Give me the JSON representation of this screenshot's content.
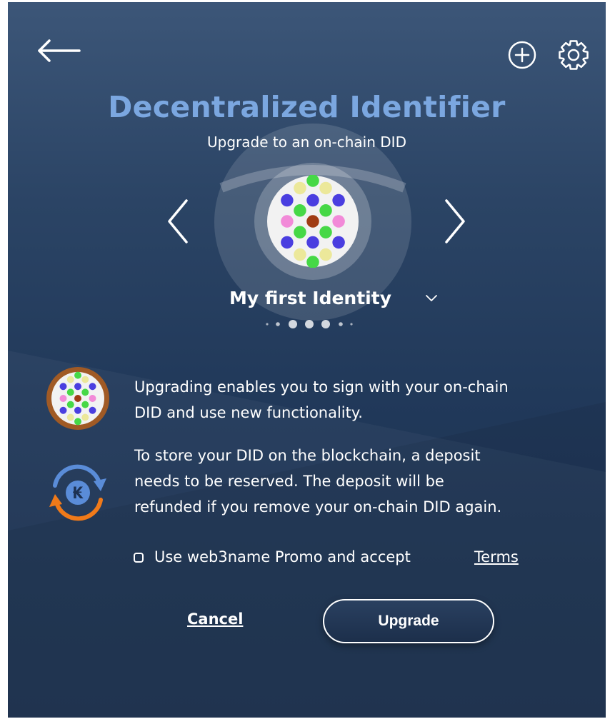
{
  "header": {
    "back_icon": "arrow-left-icon",
    "add_icon": "plus-circle-icon",
    "settings_icon": "gear-icon"
  },
  "hero": {
    "title": "Decentralized Identifier",
    "subtitle": "Upgrade to an on-chain DID"
  },
  "identity": {
    "name": "My first Identity",
    "prev_icon": "chevron-left-icon",
    "next_icon": "chevron-right-icon",
    "dropdown_icon": "chevron-down-icon",
    "carousel_count": 7,
    "carousel_active": 3
  },
  "info": [
    {
      "icon": "identicon-icon",
      "lines": [
        "Upgrading enables you to sign with your on-chain",
        "DID and use new functionality."
      ]
    },
    {
      "icon": "kilt-deposit-refund-icon",
      "lines": [
        "To store your DID on the blockchain, a deposit",
        "needs to be reserved. The deposit will be",
        "refunded if you remove your on-chain DID again."
      ]
    }
  ],
  "promo": {
    "label": "Use web3name Promo and accept",
    "terms_link": "Terms",
    "checked": false
  },
  "actions": {
    "cancel": "Cancel",
    "upgrade": "Upgrade"
  },
  "colors": {
    "title": "#7ba7e0",
    "background_top": "#3c5678",
    "background_bottom": "#1a2f4e",
    "accent_orange": "#f07a1a",
    "accent_blue": "#5a8cd8"
  }
}
